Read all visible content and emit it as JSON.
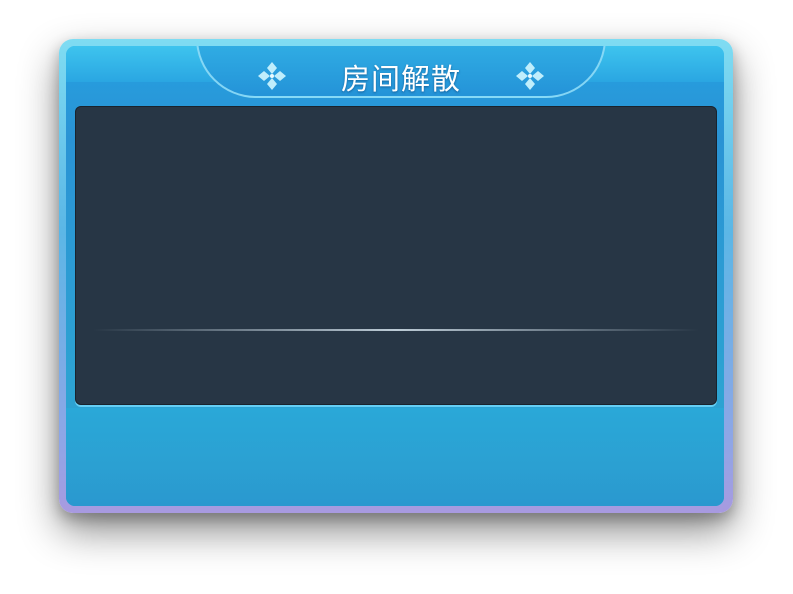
{
  "dialog": {
    "title": "房间解散",
    "ornament_icon": "four-diamond-ornament-icon",
    "colors": {
      "frame": "#5bb7e6",
      "header": "#2aa6e2",
      "panel": "#273645",
      "footer": "#2ba0d2",
      "title_text": "#ffffff"
    }
  }
}
